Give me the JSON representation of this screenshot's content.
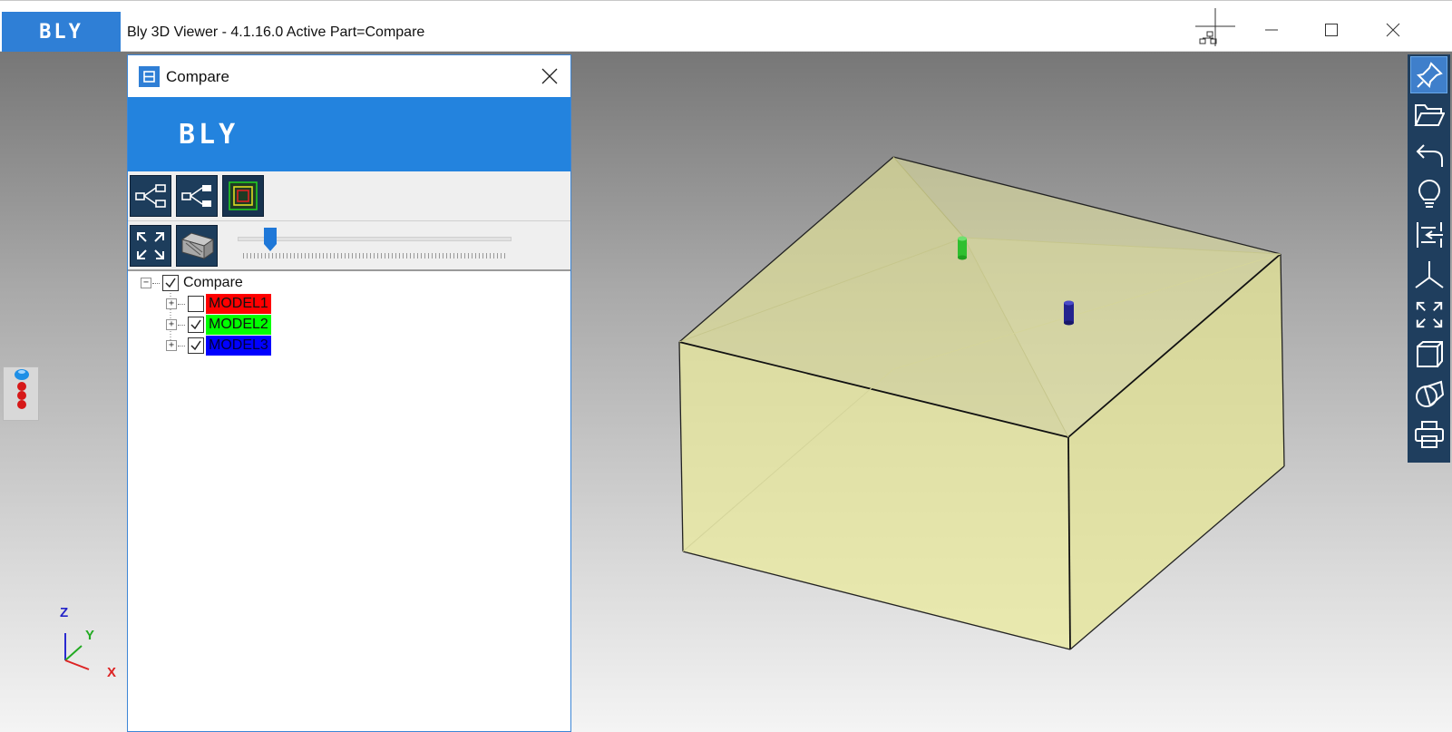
{
  "app": {
    "logo": "BLY",
    "title": "Bly 3D Viewer - 4.1.16.0 Active Part=Compare"
  },
  "window_controls": [
    "minimize",
    "maximize",
    "close"
  ],
  "panel": {
    "title": "Compare",
    "banner_logo": "BLY",
    "toolbar_row1": [
      "tree-expand-icon",
      "tree-collapse-icon",
      "layers-icon"
    ],
    "toolbar_row2": [
      "fit-view-icon",
      "section-box-icon"
    ],
    "slider": {
      "value": 0.12
    },
    "tree": {
      "root": {
        "label": "Compare",
        "checked": true
      },
      "children": [
        {
          "label": "MODEL1",
          "checked": false,
          "bg": "#ff0000"
        },
        {
          "label": "MODEL2",
          "checked": true,
          "bg": "#00ff00"
        },
        {
          "label": "MODEL3",
          "checked": true,
          "bg": "#0000ff"
        }
      ]
    }
  },
  "right_toolbar": [
    {
      "icon": "pin-icon",
      "active": true
    },
    {
      "icon": "folder-open-icon",
      "active": false
    },
    {
      "icon": "undo-icon",
      "active": false
    },
    {
      "icon": "lightbulb-icon",
      "active": false
    },
    {
      "icon": "align-icon",
      "active": false
    },
    {
      "icon": "axis-icon",
      "active": false
    },
    {
      "icon": "fit-view-icon",
      "active": false
    },
    {
      "icon": "box-view-icon",
      "active": false
    },
    {
      "icon": "shape-icon",
      "active": false
    },
    {
      "icon": "print-icon",
      "active": false
    }
  ],
  "axis": {
    "z": "Z",
    "y": "Y",
    "x": "X"
  },
  "colors": {
    "brand_blue": "#2383de",
    "toolbar_dark": "#1f3e5e",
    "box_fill": "#eeee99"
  }
}
